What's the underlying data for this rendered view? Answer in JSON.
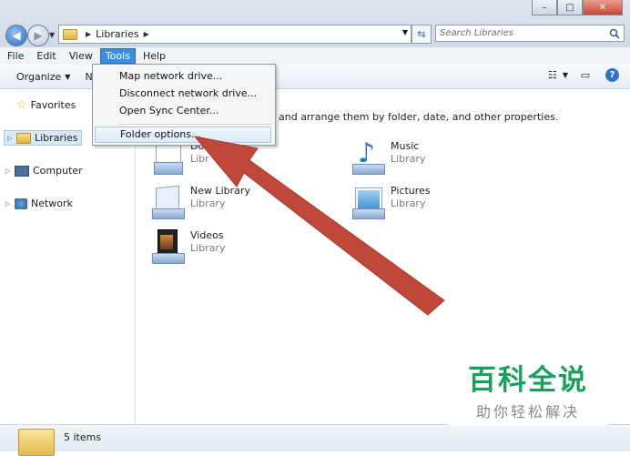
{
  "address": {
    "segment": "Libraries"
  },
  "search": {
    "placeholder": "Search Libraries"
  },
  "menu": {
    "file": "File",
    "edit": "Edit",
    "view": "View",
    "tools": "Tools",
    "help": "Help"
  },
  "toolbar": {
    "organize": "Organize",
    "next_partial": "N"
  },
  "tools_menu": {
    "items": [
      "Map network drive...",
      "Disconnect network drive...",
      "Open Sync Center...",
      "Folder options..."
    ]
  },
  "sidebar": {
    "favorites": "Favorites",
    "libraries": "Libraries",
    "computer": "Computer",
    "network": "Network"
  },
  "content": {
    "header_tail": "and arrange them by folder, date, and other properties.",
    "libraries": [
      {
        "name": "Do",
        "type": "Libr"
      },
      {
        "name": "Music",
        "type": "Library"
      },
      {
        "name": "New Library",
        "type": "Library"
      },
      {
        "name": "Pictures",
        "type": "Library"
      },
      {
        "name": "Videos",
        "type": "Library"
      }
    ]
  },
  "status": {
    "count": "5 items"
  },
  "watermark": {
    "main": "百科全说",
    "sub": "助你轻松解决"
  },
  "colors": {
    "menu_active": "#3b8ee0",
    "arrow": "#c0483a",
    "watermark": "#1aa05c"
  }
}
